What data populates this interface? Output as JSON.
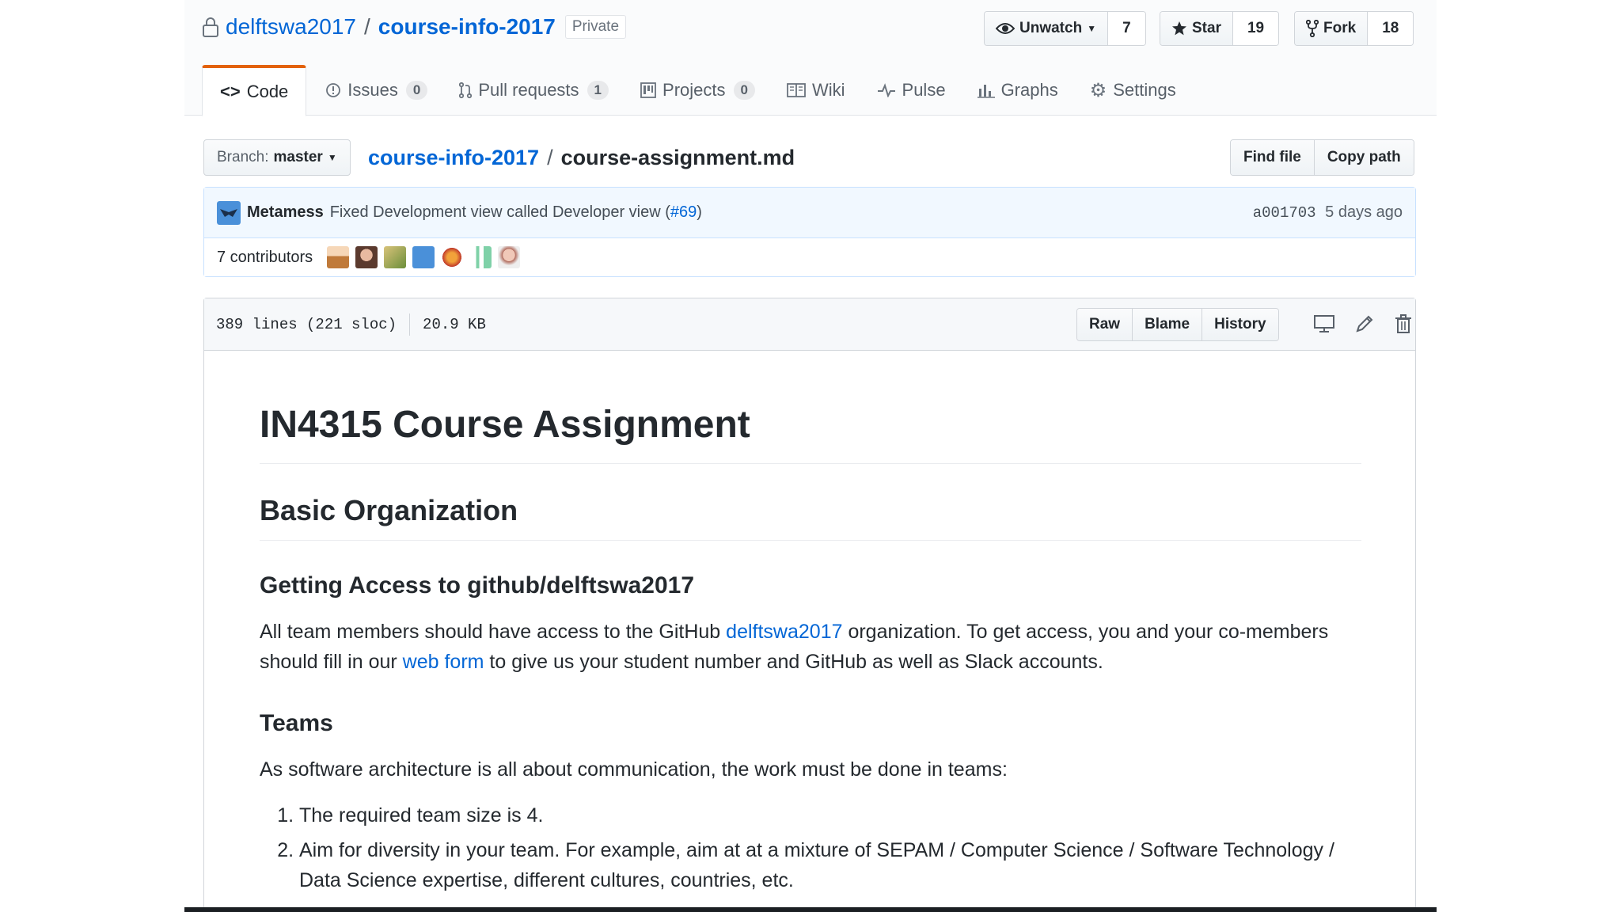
{
  "repo": {
    "owner": "delftswa2017",
    "separator": "/",
    "name": "course-info-2017",
    "visibility": "Private"
  },
  "actions": {
    "watch": {
      "label": "Unwatch",
      "count": "7"
    },
    "star": {
      "label": "Star",
      "count": "19"
    },
    "fork": {
      "label": "Fork",
      "count": "18"
    }
  },
  "tabs": [
    {
      "label": "Code",
      "icon": "code-icon"
    },
    {
      "label": "Issues",
      "count": "0",
      "icon": "issue-icon"
    },
    {
      "label": "Pull requests",
      "count": "1",
      "icon": "pull-request-icon"
    },
    {
      "label": "Projects",
      "count": "0",
      "icon": "project-icon"
    },
    {
      "label": "Wiki",
      "icon": "book-icon"
    },
    {
      "label": "Pulse",
      "icon": "pulse-icon"
    },
    {
      "label": "Graphs",
      "icon": "graph-icon"
    },
    {
      "label": "Settings",
      "icon": "gear-icon"
    }
  ],
  "file_nav": {
    "branch_label": "Branch:",
    "branch": "master",
    "path_repo": "course-info-2017",
    "path_sep": "/",
    "path_file": "course-assignment.md",
    "find_file": "Find file",
    "copy_path": "Copy path"
  },
  "commit": {
    "author": "Metamess",
    "message": "Fixed Development view called Developer view (",
    "pr_link": "#69",
    "message_end": ")",
    "sha": "a001703",
    "time": "5 days ago",
    "contributors": "7 contributors"
  },
  "colors": {
    "link": "#0366d6",
    "active_tab_accent": "#e36209",
    "commit_bg": "#f1f8ff"
  },
  "file": {
    "lines": "389 lines (221 sloc)",
    "size": "20.9 KB",
    "raw": "Raw",
    "blame": "Blame",
    "history": "History"
  },
  "markdown": {
    "h1": "IN4315 Course Assignment",
    "h2": "Basic Organization",
    "h3_access": "Getting Access to github/delftswa2017",
    "p1_a": "All team members should have access to the GitHub ",
    "p1_link1": "delftswa2017",
    "p1_b": " organization. To get access, you and your co-members should fill in our ",
    "p1_link2": "web form",
    "p1_c": " to give us your student number and GitHub as well as Slack accounts.",
    "h3_teams": "Teams",
    "p2": "As software architecture is all about communication, the work must be done in teams:",
    "list": [
      "The required team size is 4.",
      "Aim for diversity in your team. For example, aim at at a mixture of SEPAM / Computer Science / Software Technology / Data Science expertise, different cultures, countries, etc."
    ]
  }
}
